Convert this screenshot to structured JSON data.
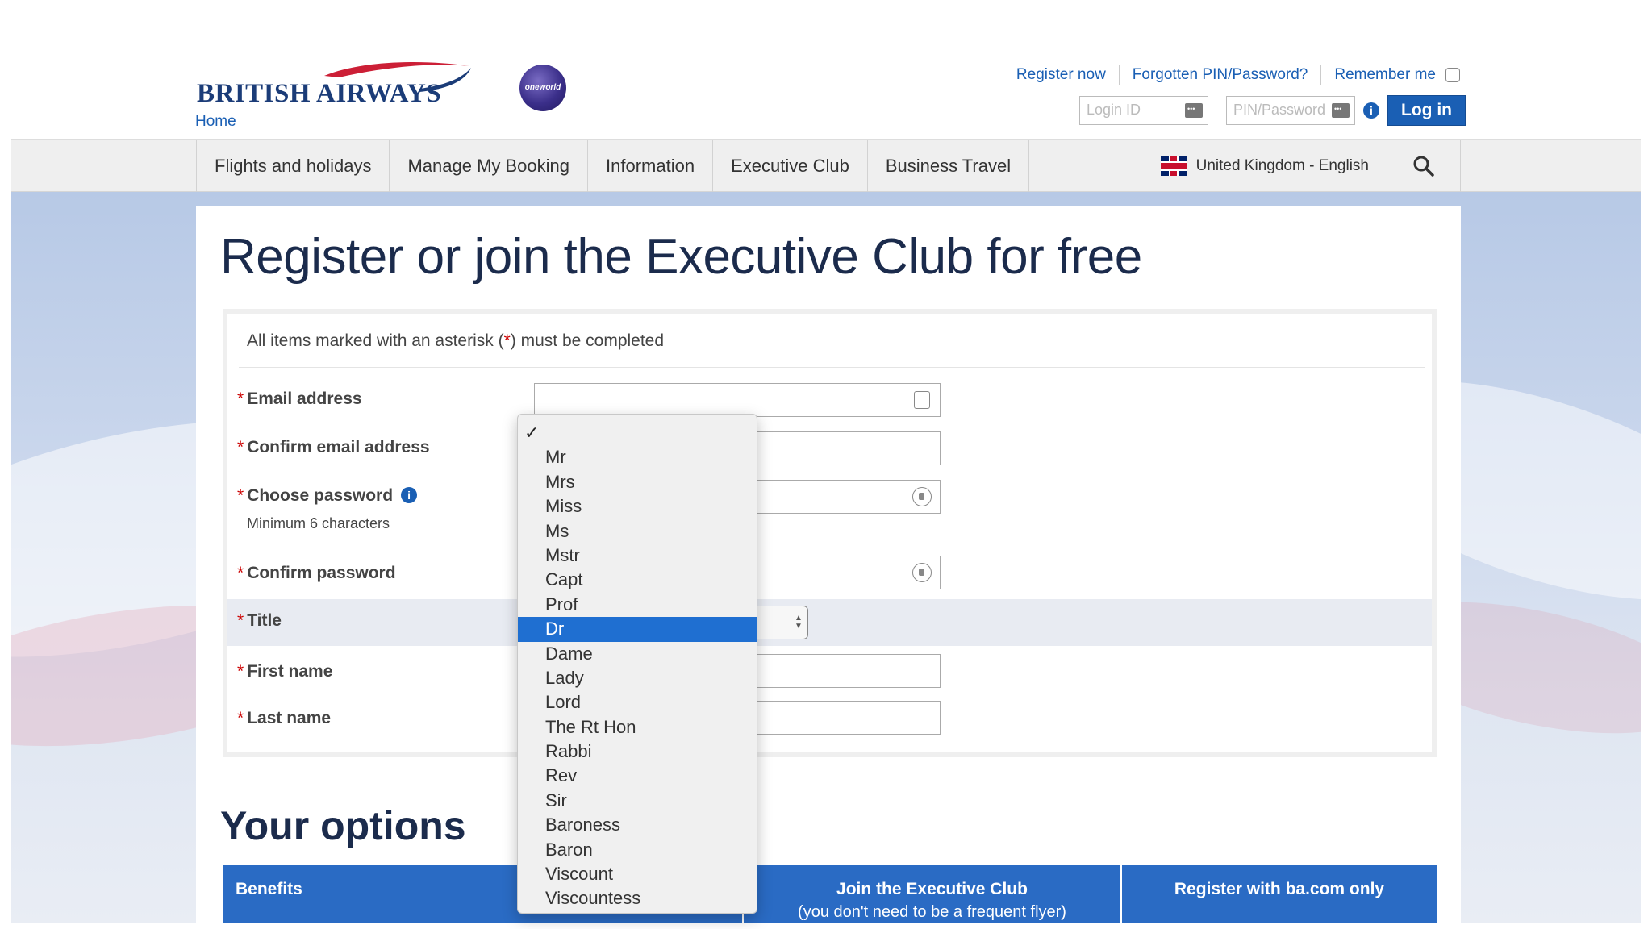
{
  "brand": {
    "logo": "BRITISH AIRWAYS",
    "home_link": "Home",
    "partner": "oneworld"
  },
  "toplinks": {
    "register": "Register now",
    "forgotten": "Forgotten PIN/Password?",
    "remember": "Remember me"
  },
  "login": {
    "login_id_placeholder": "Login ID",
    "pin_placeholder": "PIN/Password",
    "button": "Log in"
  },
  "nav": {
    "items": [
      {
        "label": "Flights and holidays"
      },
      {
        "label": "Manage My Booking"
      },
      {
        "label": "Information"
      },
      {
        "label": "Executive Club"
      },
      {
        "label": "Business Travel"
      }
    ],
    "locale": "United Kingdom - English"
  },
  "page": {
    "title": "Register or join the Executive Club for free",
    "notice_prefix": "All items marked with an asterisk (",
    "notice_ast": "*",
    "notice_suffix": ") must be completed",
    "fields": {
      "email": "Email address",
      "confirm_email": "Confirm email address",
      "password": "Choose password",
      "password_hint": "Minimum 6 characters",
      "confirm_password": "Confirm password",
      "title": "Title",
      "first_name": "First name",
      "last_name": "Last name"
    },
    "asterisk": "*"
  },
  "options": {
    "heading": "Your options",
    "benefits": "Benefits",
    "join_title": "Join the Executive Club",
    "join_sub": "(you don't need to be a frequent flyer)",
    "register_only": "Register with ba.com only"
  },
  "title_dropdown": {
    "checkmark": "✓",
    "selected": "Dr",
    "options": [
      "Mr",
      "Mrs",
      "Miss",
      "Ms",
      "Mstr",
      "Capt",
      "Prof",
      "Dr",
      "Dame",
      "Lady",
      "Lord",
      "The Rt Hon",
      "Rabbi",
      "Rev",
      "Sir",
      "Baroness",
      "Baron",
      "Viscount",
      "Viscountess"
    ]
  },
  "colors": {
    "brand_blue": "#1a5fb4",
    "heading_navy": "#1b2b4c",
    "highlight": "#1f6fd1",
    "asterisk": "#cc0000"
  }
}
